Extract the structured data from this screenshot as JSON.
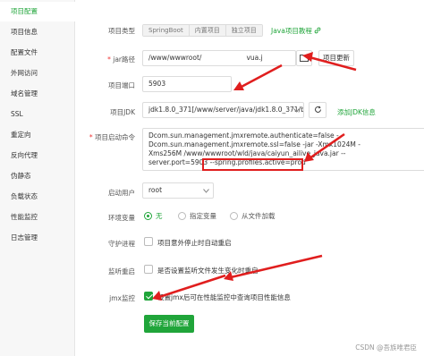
{
  "sidebar": {
    "items": [
      {
        "label": "项目配置",
        "active": true
      },
      {
        "label": "项目信息"
      },
      {
        "label": "配置文件"
      },
      {
        "label": "外网访问"
      },
      {
        "label": "域名管理"
      },
      {
        "label": "SSL"
      },
      {
        "label": "重定向"
      },
      {
        "label": "反向代理"
      },
      {
        "label": "伪静态"
      },
      {
        "label": "负载状态"
      },
      {
        "label": "性能监控"
      },
      {
        "label": "日志管理"
      }
    ]
  },
  "form": {
    "project_type": {
      "label": "项目类型",
      "options": [
        "SpringBoot",
        "内置项目",
        "独立项目"
      ],
      "selected": "SpringBoot",
      "tutorial_link": "Java项目教程"
    },
    "jar_path": {
      "label": "jar路径",
      "value": "/www/wwwroot/                     vua.j",
      "update_button": "项目更新"
    },
    "port": {
      "label": "项目端口",
      "value": "5903"
    },
    "jdk": {
      "label": "项目JDK",
      "value": "jdk1.8.0_371[/www/server/java/jdk1.8.0_371/bi",
      "add_link": "添加JDK信息"
    },
    "start_cmd": {
      "label": "项目启动命令",
      "lines": [
        "Dcom.sun.management.jmxremote.authenticate=false -",
        "Dcom.sun.management.jmxremote.ssl=false -jar  -Xmx1024M -",
        "Xms256M /www/wwwroot/wld/java/caiyun_ailive_java.jar --",
        "server.port=5903"
      ],
      "highlight": " --spring.profiles.active=prod"
    },
    "run_user": {
      "label": "启动用户",
      "value": "root"
    },
    "env": {
      "label": "环境变量",
      "options": [
        "无",
        "指定变量",
        "从文件加载"
      ],
      "selected": "无"
    },
    "daemon": {
      "label": "守护进程",
      "text": "项目意外停止时自动重启",
      "checked": false
    },
    "watch_restart": {
      "label": "监听重启",
      "text": "是否设置监听文件发生变化时重启",
      "checked": false
    },
    "jmx": {
      "label": "jmx监控",
      "text": "设置jmx后可在性能监控中查询项目性能信息",
      "checked": true
    },
    "save_button": "保存当前配置"
  },
  "watermark": "CSDN @吾族唯君臣",
  "colors": {
    "accent": "#20a53a",
    "annotation": "#e01e1e"
  },
  "icons": {
    "folder": "folder-icon",
    "link": "link-icon",
    "refresh": "refresh-icon",
    "chevron": "chevron-down-icon"
  }
}
